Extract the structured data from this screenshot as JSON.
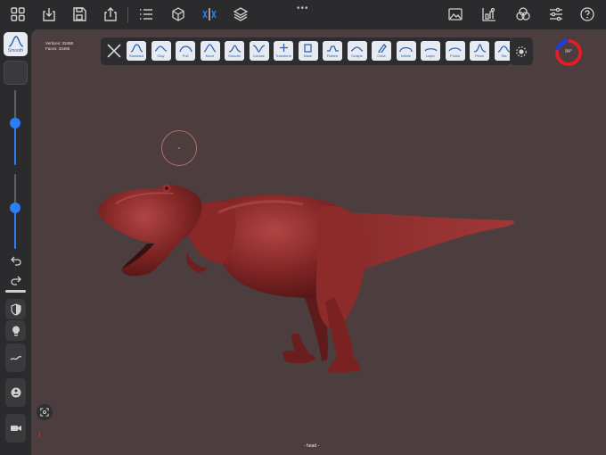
{
  "toolbar": {
    "icons": [
      "grid-icon",
      "import-icon",
      "save-icon",
      "share-icon",
      "list-icon",
      "cube-icon",
      "symmetry-icon",
      "layers-icon",
      "background-image-icon",
      "scene-icon",
      "materials-icon",
      "settings-sliders-icon",
      "help-icon"
    ],
    "dots": "•••"
  },
  "sidebar": {
    "active_tool": "Smooth",
    "radius_slider": 0.56,
    "intensity_slider": 0.55,
    "buttons": [
      "undo-icon",
      "redo-icon",
      "mask-icon",
      "light-icon",
      "stroke-icon",
      "sub-tool-icon",
      "video-icon"
    ]
  },
  "viewport": {
    "vertices_label": "Vertices:",
    "vertices_value": "33468",
    "faces_label": "Faces:",
    "faces_value": "33466",
    "object_name": "- head -",
    "model_color": "#7e2424",
    "background_color": "#4c3d3e"
  },
  "tools": [
    {
      "label": "Standard"
    },
    {
      "label": "Clay"
    },
    {
      "label": "Pull"
    },
    {
      "label": "Move"
    },
    {
      "label": "Smooth"
    },
    {
      "label": "Crease"
    },
    {
      "label": "Transform"
    },
    {
      "label": "Mask"
    },
    {
      "label": "Flatten"
    },
    {
      "label": "Scrape"
    },
    {
      "label": "Color"
    },
    {
      "label": "Inflate"
    },
    {
      "label": "Layer"
    },
    {
      "label": "Polish"
    },
    {
      "label": "Pinch"
    },
    {
      "label": "Sta"
    }
  ],
  "gauge": {
    "label": "84°",
    "fill_fraction": 0.78,
    "color_main": "#e01e24",
    "color_accent": "#1a3df0"
  },
  "colors": {
    "accent": "#2c7df6",
    "panel": "#2b2b2d",
    "tool_button": "#e7eaf0",
    "tool_label": "#2a62b8"
  }
}
